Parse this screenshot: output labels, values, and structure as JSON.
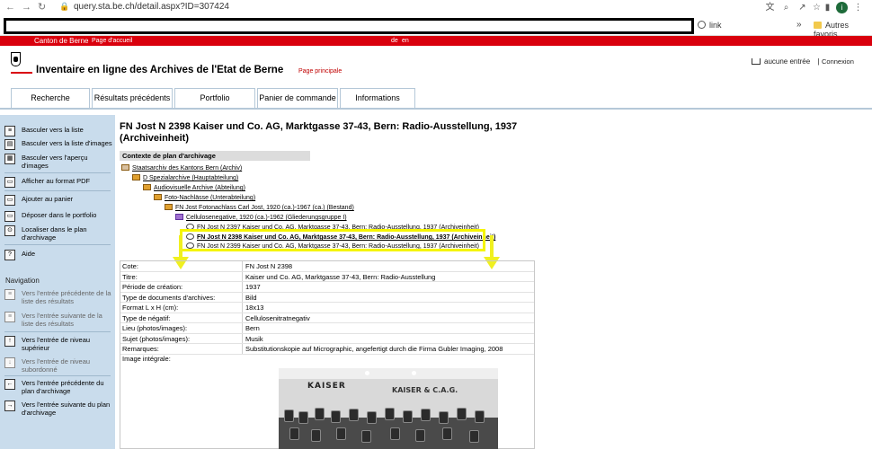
{
  "browser": {
    "url": "query.sta.be.ch/detail.aspx?ID=307424",
    "bookmark_link": "link",
    "bookmark_more": "»",
    "bookmark_fav": "Autres favoris",
    "avatar_initial": "i"
  },
  "topbar": {
    "canton": "Canton de Berne",
    "home": "Page d'accueil",
    "lang_de": "de",
    "lang_en": "en"
  },
  "header": {
    "title": "Inventaire en ligne des Archives de l'Etat de Berne",
    "subtitle": "Page principale",
    "cart": "aucune entrée",
    "separator": "|",
    "login": "Connexion"
  },
  "tabs": [
    "Recherche",
    "Résultats précédents",
    "Portfolio",
    "Panier de commande",
    "Informations"
  ],
  "sidebar": {
    "items": [
      {
        "label": "Basculer vers la liste",
        "icon": "list-icon",
        "glyph": "≡"
      },
      {
        "label": "Basculer vers la liste d'images",
        "icon": "image-list-icon",
        "glyph": "▤"
      },
      {
        "label": "Basculer vers l'aperçu d'images",
        "icon": "image-grid-icon",
        "glyph": "▦"
      },
      {
        "label": "Afficher au format PDF",
        "icon": "pdf-icon",
        "glyph": "▭"
      },
      {
        "label": "Ajouter au panier",
        "icon": "cart-icon",
        "glyph": "▭"
      },
      {
        "label": "Déposer dans le portfolio",
        "icon": "portfolio-icon",
        "glyph": "▭"
      },
      {
        "label": "Localiser dans le plan d'archivage",
        "icon": "locate-icon",
        "glyph": "⊙"
      },
      {
        "label": "Aide",
        "icon": "help-icon",
        "glyph": "?"
      }
    ],
    "nav_heading": "Navigation",
    "nav_items": [
      {
        "label": "Vers l'entrée précédente de la liste des résultats",
        "icon": "prev-result-icon",
        "glyph": "≡",
        "enabled": false
      },
      {
        "label": "Vers l'entrée suivante de la liste des résultats",
        "icon": "next-result-icon",
        "glyph": "≡",
        "enabled": false
      },
      {
        "label": "Vers l'entrée de niveau supérieur",
        "icon": "level-up-icon",
        "glyph": "↑",
        "enabled": true
      },
      {
        "label": "Vers l'entrée de niveau subordonné",
        "icon": "level-down-icon",
        "glyph": "↓",
        "enabled": false
      },
      {
        "label": "Vers l'entrée précédente du plan d'archivage",
        "icon": "prev-plan-icon",
        "glyph": "←",
        "enabled": true
      },
      {
        "label": "Vers l'entrée suivante du plan d'archivage",
        "icon": "next-plan-icon",
        "glyph": "→",
        "enabled": true
      }
    ]
  },
  "main": {
    "title": "FN Jost N 2398 Kaiser und Co. AG, Marktgasse 37-43, Bern: Radio-Ausstellung, 1937 (Archiveinheit)",
    "context_heading": "Contexte de plan d'archivage",
    "tree": [
      {
        "label": "Staatsarchiv des Kantons Bern (Archiv)",
        "icon": "home"
      },
      {
        "label": "D Spezialarchive (Hauptabteilung)",
        "icon": "folder"
      },
      {
        "label": "Audiovisuelle Archive (Abteilung)",
        "icon": "folder"
      },
      {
        "label": "Foto-Nachlässe (Unterabteilung)",
        "icon": "folder"
      },
      {
        "label": "FN Jost Fotonachlass Carl Jost, 1920 (ca.)-1967 (ca.) (Bestand)",
        "icon": "folder"
      },
      {
        "label": "Cellulosenegative, 1920 (ca.)-1962 (Gliederungsgruppe I)",
        "icon": "people"
      },
      {
        "label": "FN Jost N 2397 Kaiser und Co. AG, Marktgasse 37-43, Bern: Radio-Ausstellung, 1937 (Archiveinheit)",
        "icon": "eye"
      },
      {
        "label": "FN Jost N 2398 Kaiser und Co. AG, Marktgasse 37-43, Bern: Radio-Ausstellung, 1937 (Archiveinheit)",
        "icon": "eye"
      },
      {
        "label": "FN Jost N 2399 Kaiser und Co. AG, Marktgasse 37-43, Bern: Radio-Ausstellung, 1937 (Archiveinheit)",
        "icon": "eye"
      }
    ],
    "details": [
      {
        "key": "Cote:",
        "value": "FN Jost N 2398"
      },
      {
        "key": "Titre:",
        "value": "Kaiser und Co. AG, Marktgasse 37-43, Bern: Radio-Ausstellung"
      },
      {
        "key": "Période de création:",
        "value": "1937"
      },
      {
        "key": "Type de documents d'archives:",
        "value": "Bild"
      },
      {
        "key": "Format L x H (cm):",
        "value": "18x13"
      },
      {
        "key": "Type de négatif:",
        "value": "Cellulosenitratnegativ"
      },
      {
        "key": "Lieu (photos/images):",
        "value": "Bern"
      },
      {
        "key": "Sujet (photos/images):",
        "value": "Musik"
      },
      {
        "key": "Remarques:",
        "value": "Substitutionskopie auf Micrographic, angefertigt durch die Firma Gubler Imaging, 2008"
      }
    ],
    "image_label": "Image intégrale:",
    "photo_sign_1": "KAISER",
    "photo_sign_2": "KAISER & C.A.G."
  },
  "colors": {
    "accent_red": "#d9000d",
    "sidebar_bg": "#c9dcec",
    "highlight_yellow": "#f5f500"
  }
}
